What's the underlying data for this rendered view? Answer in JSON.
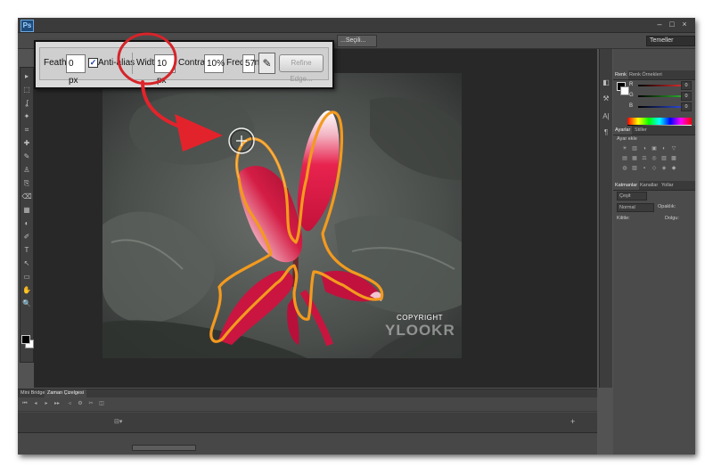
{
  "app": {
    "logo_text": "Ps",
    "window_controls": [
      "–",
      "□",
      "×"
    ]
  },
  "workspace": {
    "label": "Temeller"
  },
  "document": {
    "tab_label": "...Seçili..."
  },
  "options_bar": {
    "feather": {
      "label": "Feather:",
      "value": "0 px"
    },
    "anti_alias": {
      "label": "Anti-alias",
      "checked": true,
      "check_mark": "✓"
    },
    "width": {
      "label": "Width:",
      "value": "10 px"
    },
    "contrast": {
      "label": "Contrast:",
      "value": "10%"
    },
    "frequency": {
      "label": "Frequency:",
      "value": "57"
    },
    "pressure_icon": "pen-pressure-icon",
    "pressure_glyph": "✎",
    "refine_edge": {
      "label": "Refine Edge..."
    }
  },
  "canvas": {
    "copyright": "COPYRIGHT",
    "watermark": "YLOOKR"
  },
  "panels": {
    "color": {
      "tabs": [
        "Renk",
        "Renk Örnekleri"
      ],
      "sliders": [
        {
          "label": "R",
          "value": "0",
          "color": "#ff3333"
        },
        {
          "label": "G",
          "value": "0",
          "color": "#33cc33"
        },
        {
          "label": "B",
          "value": "0",
          "color": "#3355ff"
        }
      ]
    },
    "adjustments": {
      "tabs": [
        "Ayarlar",
        "Stiller"
      ],
      "title": "Ayar ekle"
    },
    "layers": {
      "tabs": [
        "Katmanlar",
        "Kanallar",
        "Yollar"
      ],
      "filter_label": "Çeşit",
      "blend_mode": "Normal",
      "opacity_label": "Opaklık:",
      "lock_label": "Kilitle:",
      "fill_label": "Dolgu:"
    }
  },
  "timeline": {
    "tabs": [
      "Mini Bridge",
      "Zaman Çizelgesi"
    ],
    "track_icon": "⊟▾",
    "add_button": "+"
  },
  "tools": {
    "glyphs": [
      "▸",
      "⬚",
      "ʆ",
      "✦",
      "⌗",
      "✚",
      "✎",
      "♙",
      "⎘",
      "⌫",
      "▦",
      "◐",
      "✐",
      "T",
      "↖",
      "▭",
      "✋",
      "🔍"
    ]
  },
  "right_icons": {
    "glyphs": [
      "◧",
      "⚒",
      "A|",
      "¶"
    ]
  },
  "colors": {
    "window_bg": "#535353",
    "canvas_bg": "#282828",
    "selection_outline": "#f39a1e",
    "callout_circle": "#d6242a",
    "arrow": "#e3232b"
  }
}
